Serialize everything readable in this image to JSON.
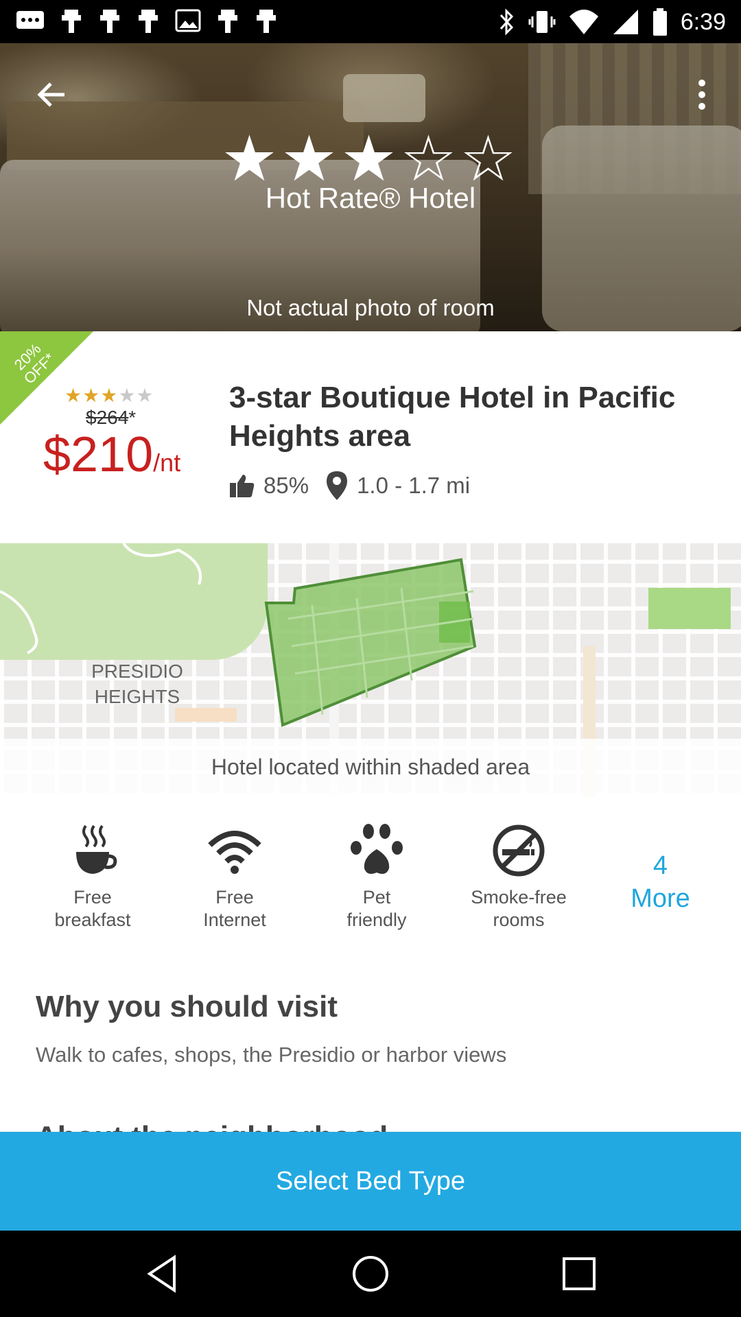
{
  "status_bar": {
    "time": "6:39"
  },
  "hero": {
    "star_rating": 3,
    "star_max": 5,
    "title": "Hot Rate® Hotel",
    "caption": "Not actual photo of room"
  },
  "offer": {
    "discount": "20% OFF*",
    "stars_on": "★★★",
    "stars_off": "★★",
    "old_price": "$264",
    "old_price_note": "*",
    "price": "$210",
    "price_unit": "/nt"
  },
  "hotel": {
    "title": "3-star Boutique Hotel in Pacific Heights area",
    "recommend": "85%",
    "distance": "1.0 - 1.7 mi"
  },
  "map": {
    "area_label_line1": "PRESIDIO",
    "area_label_line2": "HEIGHTS",
    "caption": "Hotel located within shaded area",
    "shaded_color": "#8dc76a"
  },
  "amenities": [
    {
      "line1": "Free",
      "line2": "breakfast",
      "icon": "coffee-cup-icon"
    },
    {
      "line1": "Free",
      "line2": "Internet",
      "icon": "wifi-icon"
    },
    {
      "line1": "Pet",
      "line2": "friendly",
      "icon": "paw-icon"
    },
    {
      "line1": "Smoke-free",
      "line2": "rooms",
      "icon": "no-smoking-icon"
    }
  ],
  "more": {
    "count": "4",
    "label": "More"
  },
  "why": {
    "title": "Why you should visit",
    "text": "Walk to cafes, shops, the Presidio or harbor views"
  },
  "next_section_title": "About the neighborhood",
  "cta": {
    "label": "Select Bed Type"
  },
  "colors": {
    "accent": "#23a9e1",
    "price": "#c8201f",
    "discount": "#8dc63f",
    "stars": "#e0a526"
  }
}
